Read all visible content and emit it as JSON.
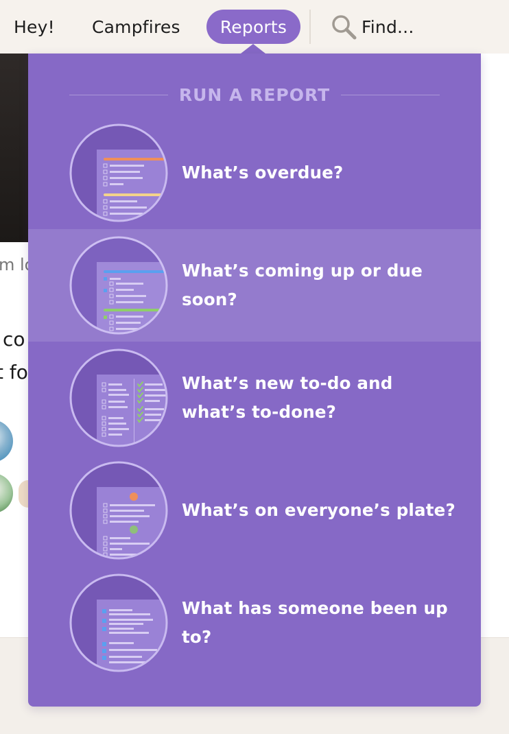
{
  "nav": {
    "hey_label": "Hey!",
    "campfires_label": "Campfires",
    "reports_label": "Reports",
    "find_label": "Find..."
  },
  "background": {
    "snippet": "m lo",
    "line1": "co",
    "line2": "t fo"
  },
  "dropdown": {
    "heading": "RUN A REPORT",
    "items": [
      {
        "label": "What’s overdue?",
        "icon": "overdue-report-icon"
      },
      {
        "label": "What’s coming up or due soon?",
        "icon": "upcoming-report-icon"
      },
      {
        "label": "What’s new to-do and what’s to-done?",
        "icon": "todo-done-report-icon"
      },
      {
        "label": "What’s on everyone’s plate?",
        "icon": "everyone-plate-report-icon"
      },
      {
        "label": "What has someone been up to?",
        "icon": "someone-activity-report-icon"
      }
    ]
  },
  "colors": {
    "accent": "#8669c6",
    "reports_pill": "#8a6ac9",
    "heading_text": "#c6b6ec",
    "overdue_orange": "#ef8f5a",
    "upcoming_blue": "#5aa0f0",
    "done_green": "#8fcf6a"
  }
}
